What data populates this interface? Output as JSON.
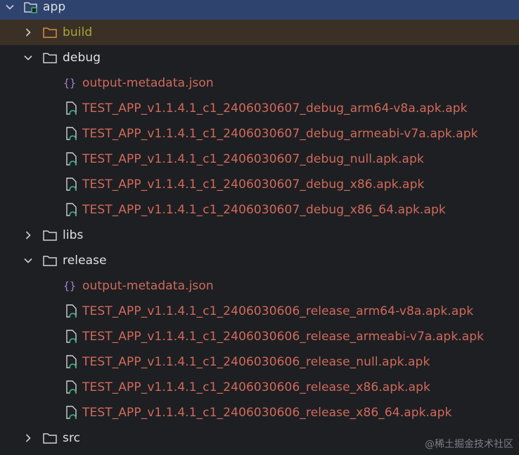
{
  "tree": {
    "root": {
      "label": "app"
    },
    "build": {
      "label": "build"
    },
    "debug": {
      "label": "debug",
      "files": [
        "output-metadata.json",
        "TEST_APP_v1.1.4.1_c1_2406030607_debug_arm64-v8a.apk.apk",
        "TEST_APP_v1.1.4.1_c1_2406030607_debug_armeabi-v7a.apk.apk",
        "TEST_APP_v1.1.4.1_c1_2406030607_debug_null.apk.apk",
        "TEST_APP_v1.1.4.1_c1_2406030607_debug_x86.apk.apk",
        "TEST_APP_v1.1.4.1_c1_2406030607_debug_x86_64.apk.apk"
      ]
    },
    "libs": {
      "label": "libs"
    },
    "release": {
      "label": "release",
      "files": [
        "output-metadata.json",
        "TEST_APP_v1.1.4.1_c1_2406030606_release_arm64-v8a.apk.apk",
        "TEST_APP_v1.1.4.1_c1_2406030606_release_armeabi-v7a.apk.apk",
        "TEST_APP_v1.1.4.1_c1_2406030606_release_null.apk.apk",
        "TEST_APP_v1.1.4.1_c1_2406030606_release_x86.apk.apk",
        "TEST_APP_v1.1.4.1_c1_2406030606_release_x86_64.apk.apk"
      ]
    },
    "src": {
      "label": "src"
    }
  },
  "watermark": "@稀土掘金技术社区",
  "colors": {
    "background": "#1e1f22",
    "selection": "#2e436e",
    "excluded_folder_row": "#3b3025",
    "excluded_text": "#a9a43b",
    "unversioned_text": "#d06a5c",
    "default_text": "#dfe1e5",
    "json_icon": "#a67fd6",
    "apk_icon": "#3fb37f"
  }
}
